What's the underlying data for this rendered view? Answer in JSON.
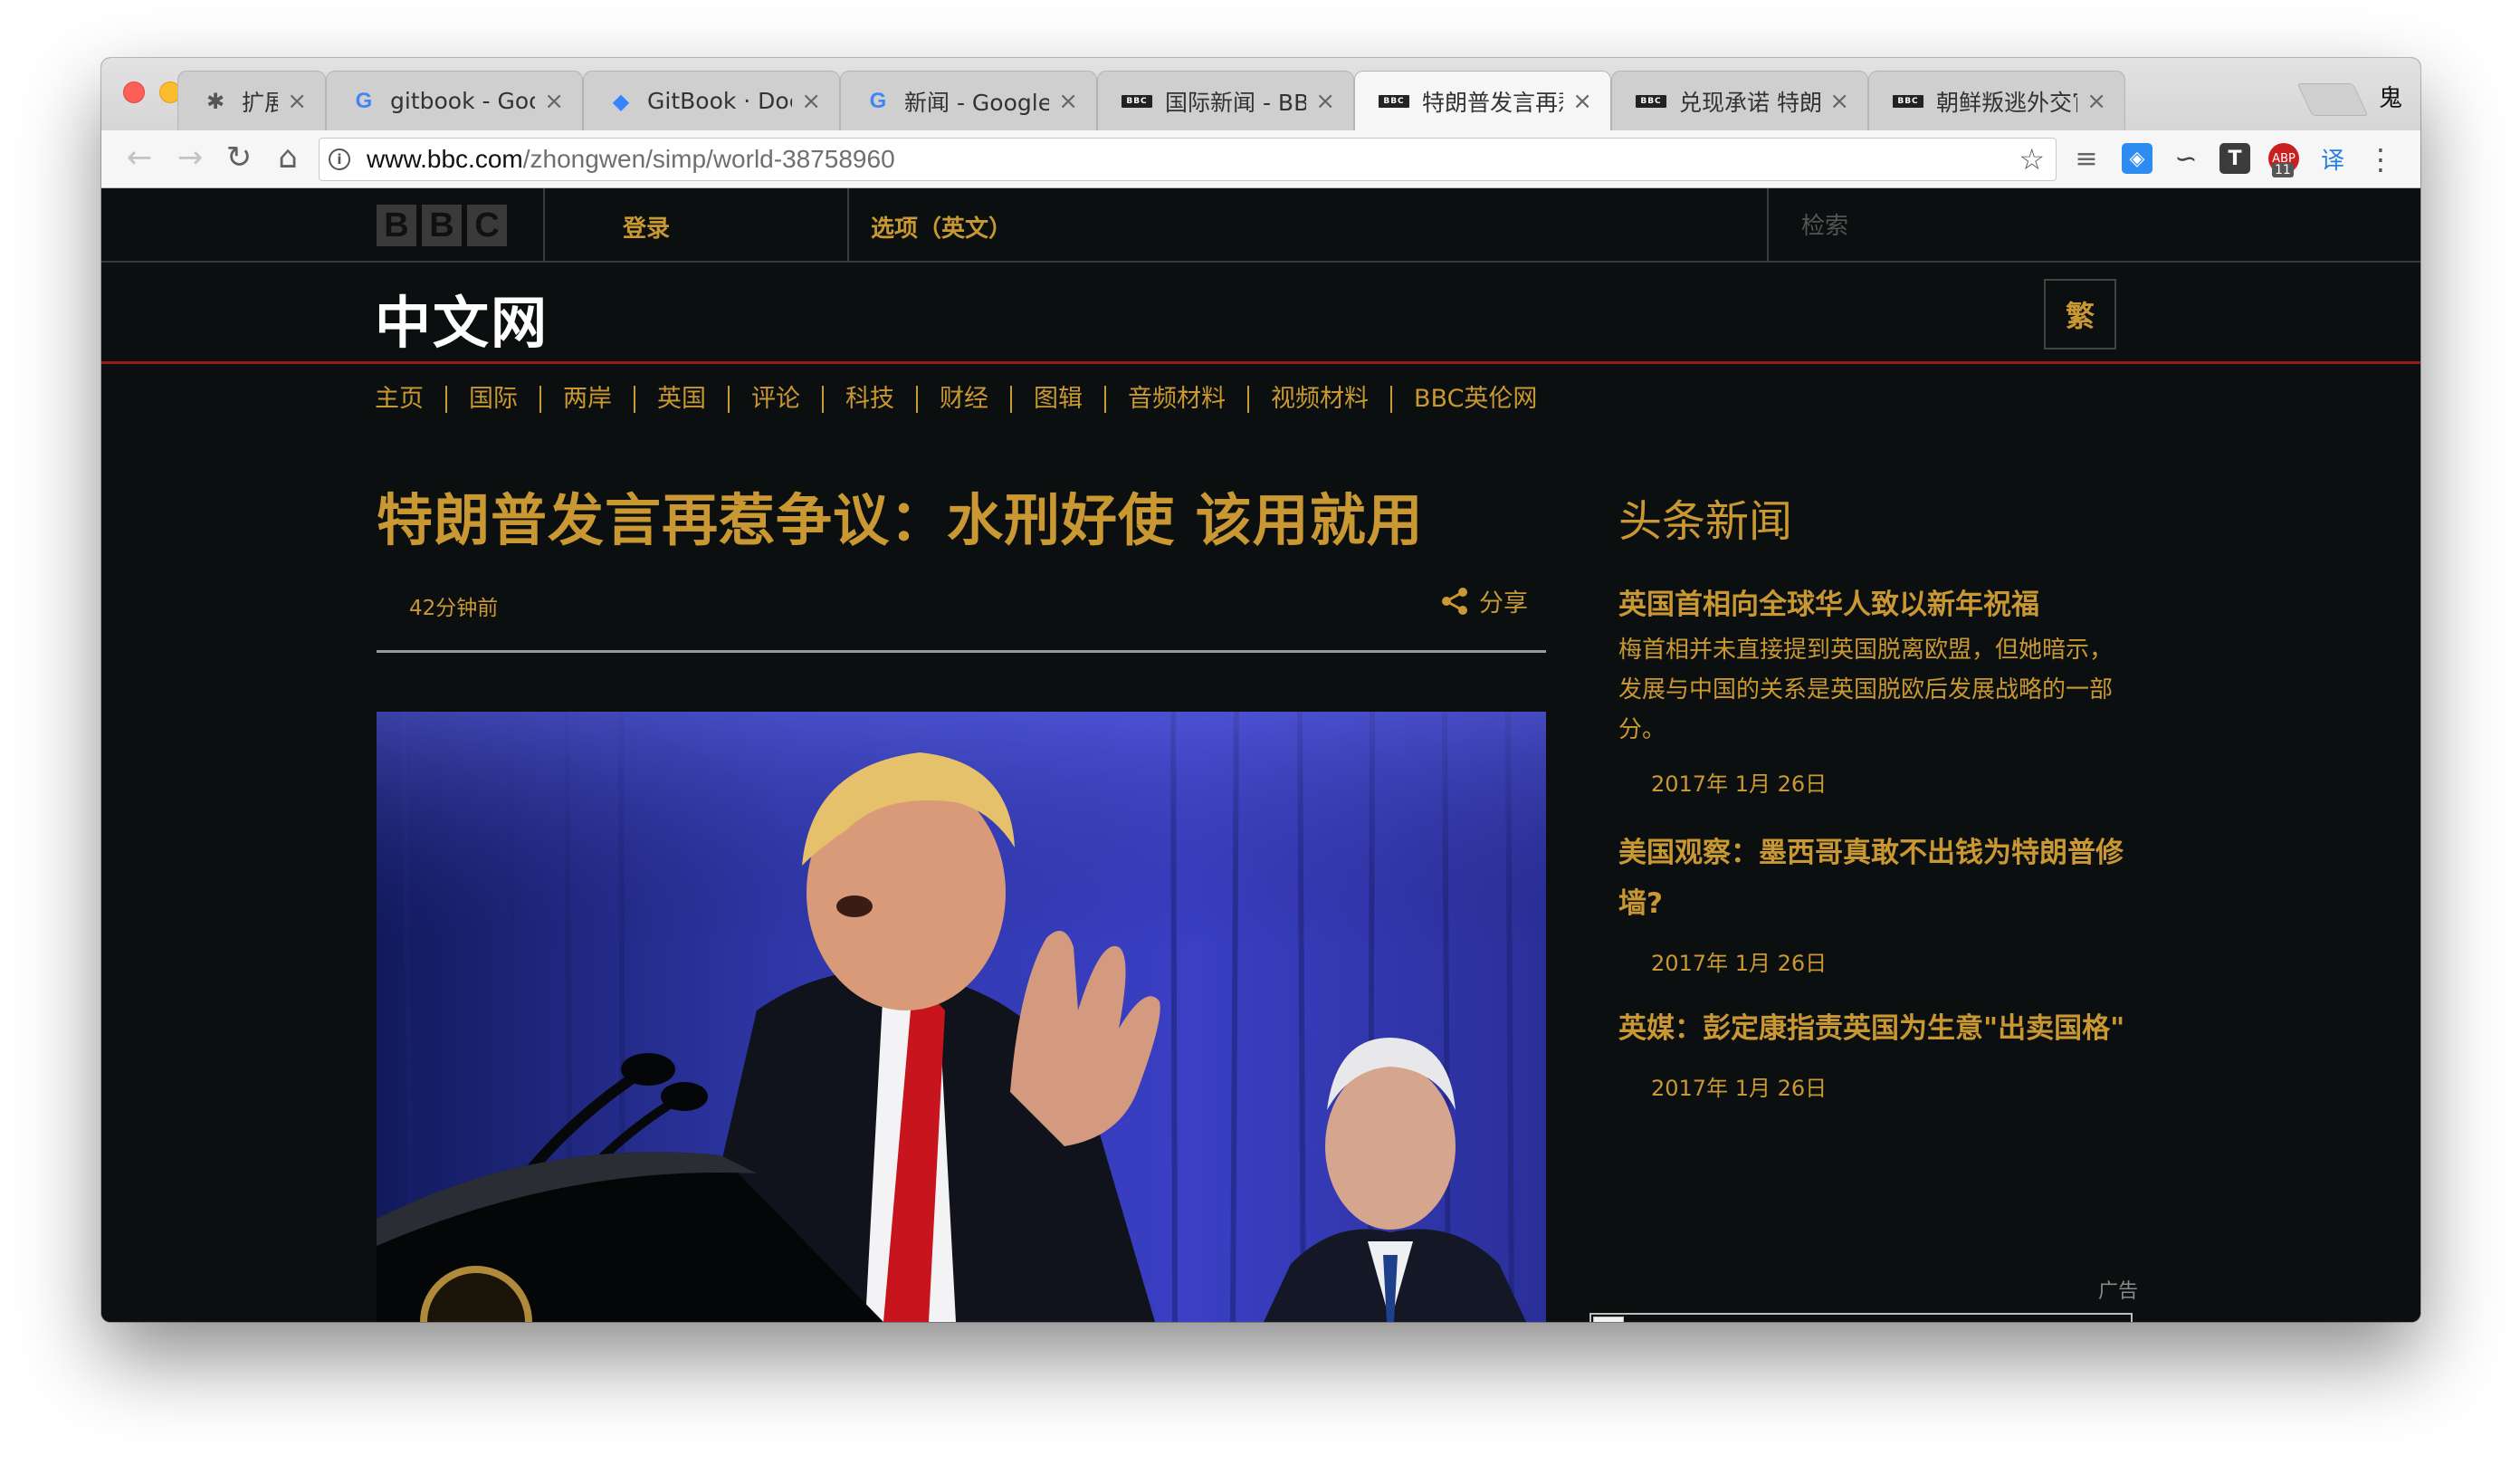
{
  "browser": {
    "tabs": [
      {
        "favicon": "puzzle-icon",
        "title": "扩展程序",
        "active": false
      },
      {
        "favicon": "google-icon",
        "title": "gitbook - Goog",
        "active": false
      },
      {
        "favicon": "gitbook-icon",
        "title": "GitBook · Docu",
        "active": false
      },
      {
        "favicon": "google-icon",
        "title": "新闻 - Google 搜",
        "active": false
      },
      {
        "favicon": "bbc-icon",
        "title": "国际新闻 - BBC",
        "active": false
      },
      {
        "favicon": "bbc-icon",
        "title": "特朗普发言再惹",
        "active": true
      },
      {
        "favicon": "bbc-icon",
        "title": "兑现承诺 特朗普",
        "active": false
      },
      {
        "favicon": "bbc-icon",
        "title": "朝鲜叛逃外交官",
        "active": false
      }
    ],
    "profile_label": "鬼",
    "url_host": "www.bbc.com",
    "url_path": "/zhongwen/simp/world-38758960",
    "abp_badge": "11",
    "translate_label": "译"
  },
  "bbc_bar": {
    "logo_letters": [
      "B",
      "B",
      "C"
    ],
    "signin": "登录",
    "options": "选项（英文）",
    "search_placeholder": "检索"
  },
  "site": {
    "title": "中文网",
    "traditional_toggle": "繁"
  },
  "nav": [
    "主页",
    "国际",
    "两岸",
    "英国",
    "评论",
    "科技",
    "财经",
    "图辑",
    "音频材料",
    "视频材料",
    "BBC英伦网"
  ],
  "article": {
    "headline": "特朗普发言再惹争议：水刑好使 该用就用",
    "timestamp": "42分钟前",
    "share_label": "分享"
  },
  "sidebar": {
    "title": "头条新闻",
    "stories": [
      {
        "title": "英国首相向全球华人致以新年祝福",
        "summary": "梅首相并未直接提到英国脱离欧盟，但她暗示，发展与中国的关系是英国脱欧后发展战略的一部分。",
        "date": "2017年 1月 26日"
      },
      {
        "title": "美国观察：墨西哥真敢不出钱为特朗普修墙?",
        "summary": "",
        "date": "2017年 1月 26日"
      },
      {
        "title": "英媒：彭定康指责英国为生意\"出卖国格\"",
        "summary": "",
        "date": "2017年 1月 26日"
      }
    ],
    "ad_label": "广告"
  },
  "colors": {
    "accent": "#c99832",
    "page_bg": "#0b0f10",
    "header_rule": "#9a1a1a"
  }
}
